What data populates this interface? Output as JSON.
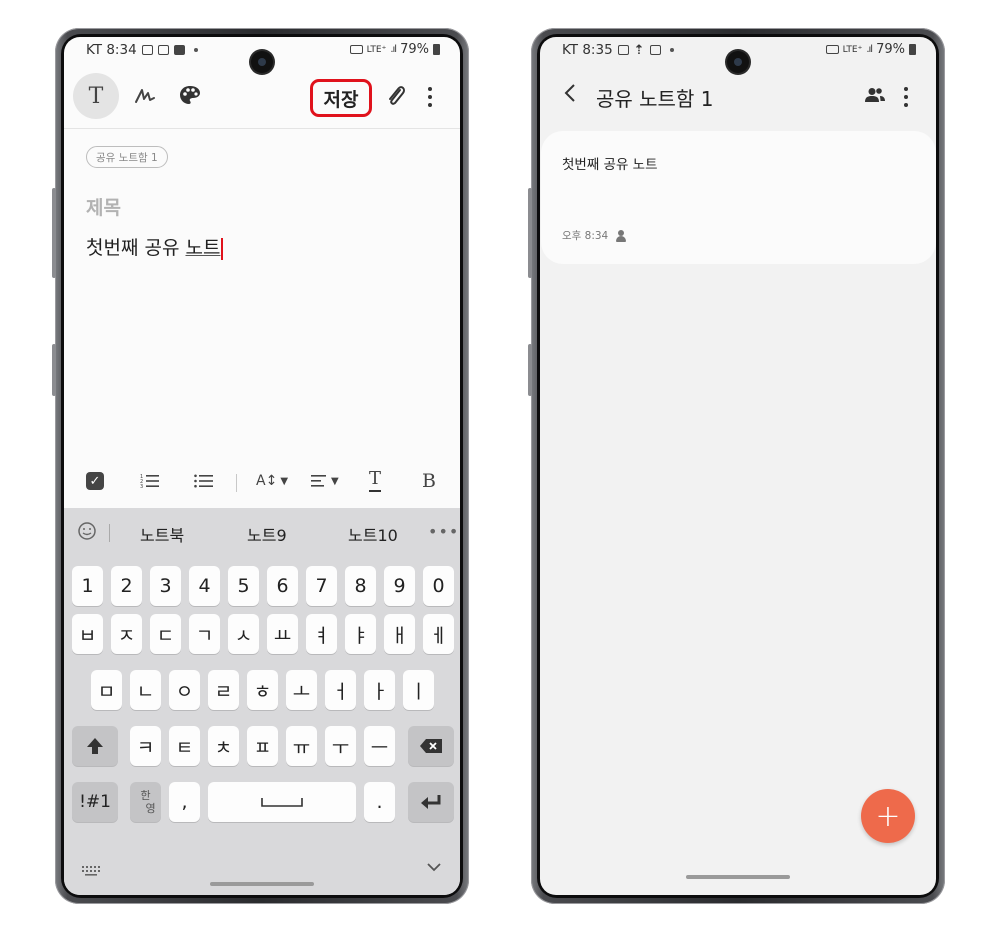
{
  "left_screen": {
    "status": {
      "carrier_time": "KT 8:34",
      "network": "LTE⁺",
      "battery": "79%"
    },
    "toolbar": {
      "text_mode": "T",
      "save_label": "저장"
    },
    "folder_chip": "공유 노트함 1",
    "title_placeholder": "제목",
    "body_text_plain": "첫번째 공유 ",
    "body_text_underlined": "노트",
    "format_bar": {
      "size_label": "A↕",
      "font_color_label": "T",
      "bold_label": "B"
    },
    "keyboard": {
      "suggestions": [
        "노트북",
        "노트9",
        "노트10"
      ],
      "number_row": [
        "1",
        "2",
        "3",
        "4",
        "5",
        "6",
        "7",
        "8",
        "9",
        "0"
      ],
      "row1": [
        "ㅂ",
        "ㅈ",
        "ㄷ",
        "ㄱ",
        "ㅅ",
        "ㅛ",
        "ㅕ",
        "ㅑ",
        "ㅐ",
        "ㅔ"
      ],
      "row2": [
        "ㅁ",
        "ㄴ",
        "ㅇ",
        "ㄹ",
        "ㅎ",
        "ㅗ",
        "ㅓ",
        "ㅏ",
        "ㅣ"
      ],
      "row3": [
        "ㅋ",
        "ㅌ",
        "ㅊ",
        "ㅍ",
        "ㅠ",
        "ㅜ",
        "ㅡ"
      ],
      "sym_key": "!#1",
      "lang_key_top": "한",
      "lang_key_bottom": "영",
      "comma_key": ",",
      "period_key": "."
    }
  },
  "right_screen": {
    "status": {
      "carrier_time": "KT 8:35",
      "network": "LTE⁺",
      "battery": "79%"
    },
    "header_title": "공유 노트함 1",
    "note": {
      "title": "첫번째 공유 노트",
      "time": "오후 8:34"
    },
    "fab_label": "+"
  },
  "colors": {
    "save_highlight": "#e0121c",
    "fab": "#ee6a4b",
    "keyboard_bg": "#d9d9db"
  },
  "icons": [
    "pen-icon",
    "palette-icon",
    "attach-icon",
    "more-icon",
    "checkbox-icon",
    "numbered-list-icon",
    "bullet-list-icon",
    "text-size-icon",
    "align-icon",
    "font-color-icon",
    "bold-icon",
    "emoji-icon",
    "shift-icon",
    "backspace-icon",
    "enter-icon",
    "keyboard-icon",
    "chevron-down-icon",
    "back-icon",
    "people-icon",
    "person-icon",
    "add-icon"
  ]
}
